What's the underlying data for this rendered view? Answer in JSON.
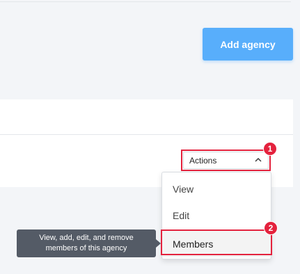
{
  "header": {
    "add_agency_label": "Add agency"
  },
  "row_actions": {
    "actions_label": "Actions",
    "toggle_icon": "chevron-up-icon",
    "menu_items": [
      {
        "label": "View"
      },
      {
        "label": "Edit"
      },
      {
        "label": "Members"
      }
    ]
  },
  "annotations": {
    "step_1": "1",
    "step_2": "2",
    "tooltip_text": "View, add, edit, and remove members of this agency",
    "highlight_color": "#e4223d"
  },
  "colors": {
    "primary_button": "#58aefb",
    "tooltip_background": "#545b66"
  }
}
